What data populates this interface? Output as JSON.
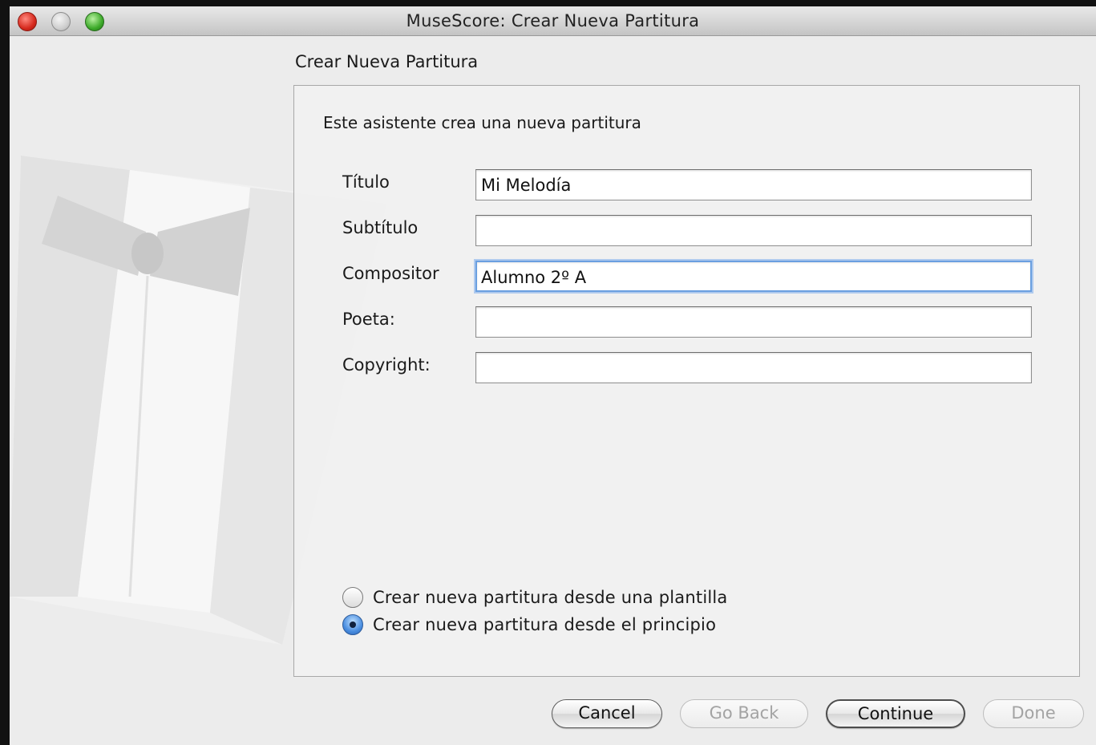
{
  "window": {
    "title": "MuseScore: Crear Nueva Partitura"
  },
  "page": {
    "heading": "Crear Nueva Partitura"
  },
  "panel": {
    "intro": "Este asistente crea una nueva partitura",
    "fields": [
      {
        "label": "Título",
        "value": "Mi Melodía"
      },
      {
        "label": "Subtítulo",
        "value": ""
      },
      {
        "label": "Compositor",
        "value": "Alumno 2º A"
      },
      {
        "label": "Poeta:",
        "value": ""
      },
      {
        "label": "Copyright:",
        "value": ""
      }
    ],
    "focused_field": "Compositor",
    "options": [
      {
        "label": "Crear nueva partitura desde una plantilla",
        "selected": false
      },
      {
        "label": "Crear nueva partitura desde el principio",
        "selected": true
      }
    ]
  },
  "buttons": {
    "cancel": {
      "label": "Cancel",
      "enabled": true
    },
    "go_back": {
      "label": "Go Back",
      "enabled": false
    },
    "continue": {
      "label": "Continue",
      "enabled": true
    },
    "done": {
      "label": "Done",
      "enabled": false
    }
  },
  "icons": {
    "close": "close-dot-icon",
    "minimize": "minimize-dot-icon",
    "zoom": "zoom-dot-icon",
    "watermark": "tuxedo-watermark-icon"
  },
  "colors": {
    "close": "#d62a1e",
    "minimize": "#cfcfcf",
    "zoom": "#3daa2a",
    "focus_ring": "#6a9fe0",
    "radio_selected": "#4a8ee0"
  }
}
